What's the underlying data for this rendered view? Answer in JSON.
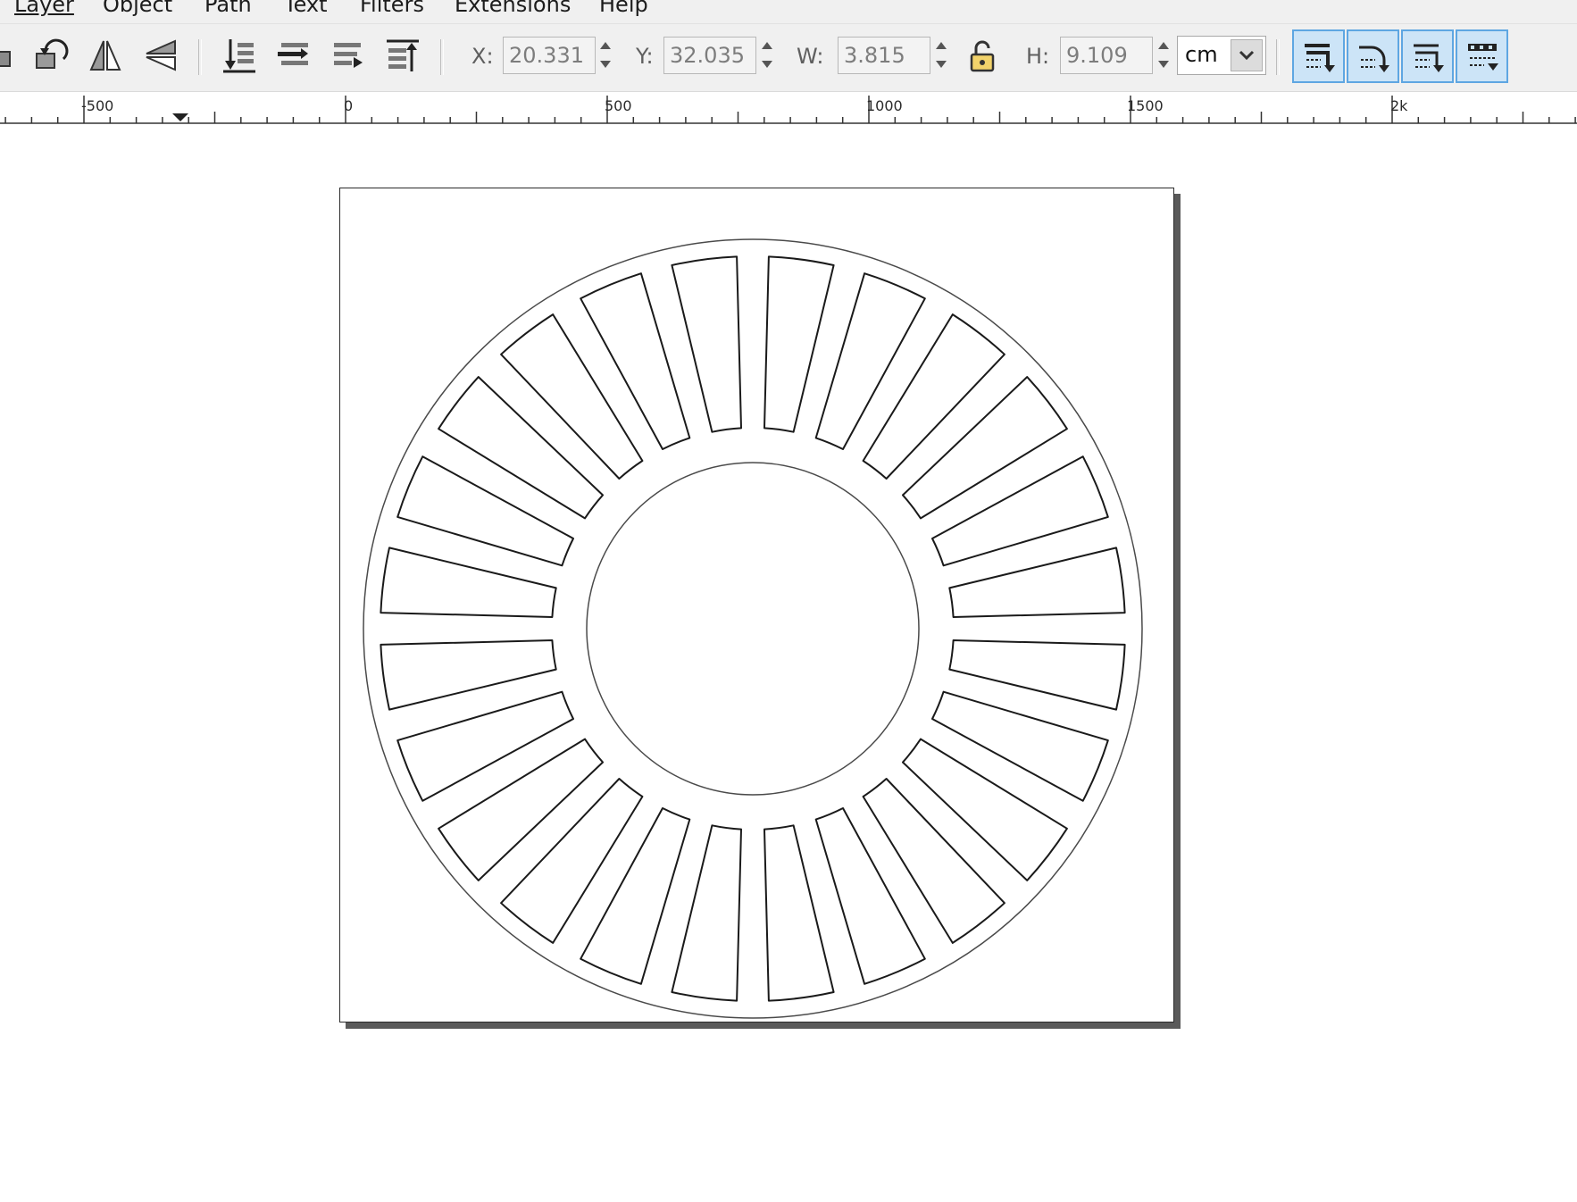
{
  "menu": {
    "items": [
      "Layer",
      "Object",
      "Path",
      "Text",
      "Filters",
      "Extensions",
      "Help"
    ]
  },
  "toolbar": {
    "transform_tools": [
      "rotate-ccw-icon",
      "rotate-cw-icon",
      "flip-horizontal-icon",
      "flip-vertical-icon"
    ],
    "z_order_tools": [
      "lower-to-bottom-icon",
      "lower-icon",
      "raise-icon",
      "raise-to-top-icon"
    ],
    "x": {
      "label": "X:",
      "value": "20.331"
    },
    "y": {
      "label": "Y:",
      "value": "32.035"
    },
    "w": {
      "label": "W:",
      "value": "3.815"
    },
    "h": {
      "label": "H:",
      "value": "9.109"
    },
    "lock_icon": "lock-open-icon",
    "unit": "cm",
    "scale_toggles": [
      "scale-stroke-icon",
      "scale-corners-icon",
      "move-gradients-icon",
      "move-patterns-icon"
    ],
    "accent_color": "#cce4f7"
  },
  "ruler": {
    "labels": [
      "-500",
      "0",
      "500",
      "1000",
      "1500",
      "2k"
    ]
  },
  "drawing": {
    "slot_count": 24,
    "stroke_color": "#1a1a1a",
    "background_color": "#ffffff"
  }
}
